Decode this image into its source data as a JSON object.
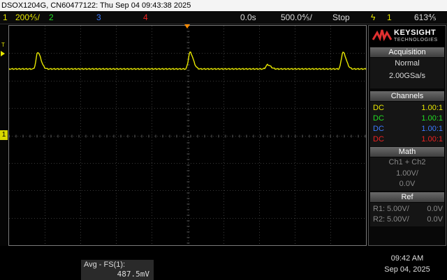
{
  "title_bar": "DSOX1204G, CN60477122: Thu Sep 04 09:43:38 2025",
  "status": {
    "ch1_num": "1",
    "ch1_scale": "200⅘/",
    "ch2_num": "2",
    "ch3_num": "3",
    "ch4_num": "4",
    "time_offset": "0.0s",
    "time_scale": "500.0⅘/",
    "run_state": "Stop",
    "trigger_icon": "ϟ",
    "trigger_source": "1",
    "trigger_level": "613⅘"
  },
  "markers": {
    "trigger_marker": "T",
    "ground_marker": "1"
  },
  "brand": {
    "name": "KEYSIGHT",
    "sub": "TECHNOLOGIES"
  },
  "acquisition": {
    "title": "Acquisition",
    "mode": "Normal",
    "rate": "2.00GSa/s"
  },
  "channels": {
    "title": "Channels",
    "rows": [
      {
        "coupling": "DC",
        "ratio": "1.00:1",
        "color": "#e8e800"
      },
      {
        "coupling": "DC",
        "ratio": "1.00:1",
        "color": "#22dd22"
      },
      {
        "coupling": "DC",
        "ratio": "1.00:1",
        "color": "#3d7bff"
      },
      {
        "coupling": "DC",
        "ratio": "1.00:1",
        "color": "#ee2222"
      }
    ]
  },
  "math": {
    "title": "Math",
    "expr": "Ch1 + Ch2",
    "scale": "1.00V/",
    "offset": "0.0V"
  },
  "ref": {
    "title": "Ref",
    "r1": {
      "label": "R1:",
      "scale": "5.00V/",
      "offset": "0.0V"
    },
    "r2": {
      "label": "R2:",
      "scale": "5.00V/",
      "offset": "0.0V"
    }
  },
  "measurement": {
    "label": "Avg - FS(1):",
    "value": "487.5mV"
  },
  "clock": {
    "time": "09:42 AM",
    "date": "Sep 04, 2025"
  },
  "colors": {
    "ch1": "#e8e800",
    "ch2": "#22dd22",
    "ch3": "#3d7bff",
    "ch4": "#ee2222",
    "trigger_marker": "#ff8c00"
  }
}
